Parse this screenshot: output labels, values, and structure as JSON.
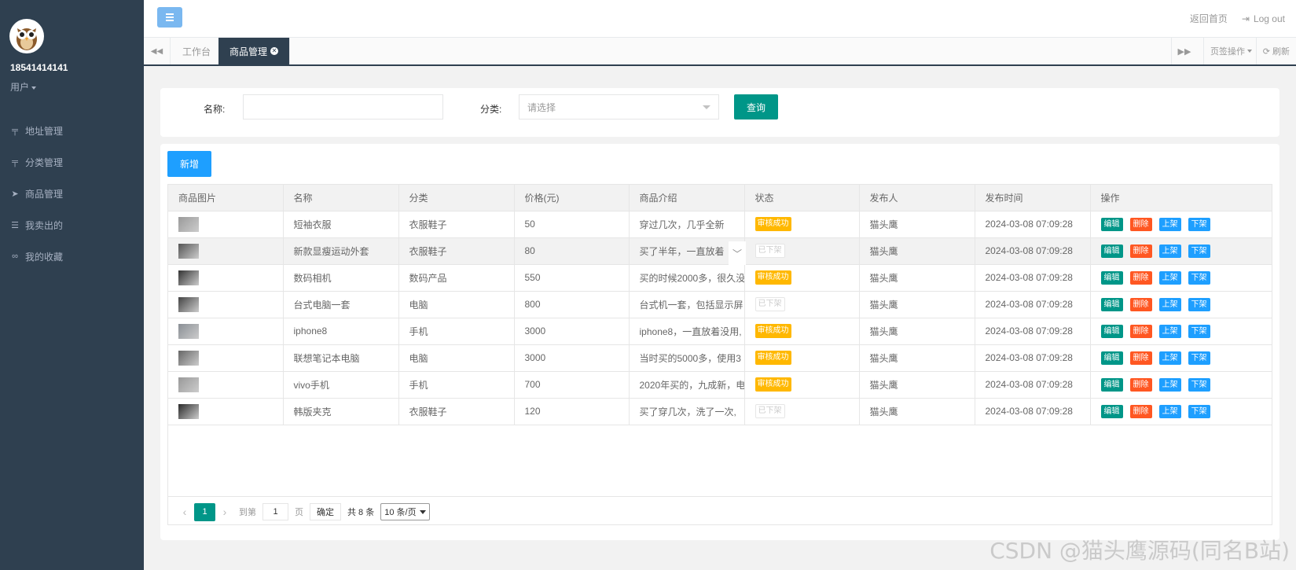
{
  "user": {
    "name": "18541414141",
    "role": "用户"
  },
  "menu": [
    {
      "label": "地址管理",
      "icon": "road-icon"
    },
    {
      "label": "分类管理",
      "icon": "road-icon"
    },
    {
      "label": "商品管理",
      "icon": "paper-plane-icon"
    },
    {
      "label": "我卖出的",
      "icon": "sliders-icon"
    },
    {
      "label": "我的收藏",
      "icon": "link-icon"
    }
  ],
  "header": {
    "home_label": "返回首页",
    "logout_label": "Log out"
  },
  "tabs": [
    {
      "label": "工作台",
      "active": false
    },
    {
      "label": "商品管理",
      "active": true
    }
  ],
  "tab_actions": {
    "page_ops": "页签操作",
    "refresh": "刷新"
  },
  "search": {
    "name_label": "名称:",
    "name_value": "",
    "category_label": "分类:",
    "category_placeholder": "请选择",
    "query_button": "查询"
  },
  "toolbar": {
    "add_button": "新增"
  },
  "table": {
    "columns": [
      "商品图片",
      "名称",
      "分类",
      "价格(元)",
      "商品介绍",
      "状态",
      "发布人",
      "发布时间",
      "操作"
    ],
    "actions": {
      "edit": "编辑",
      "delete": "删除",
      "list": "上架",
      "delist": "下架"
    },
    "rows": [
      {
        "name": "短袖衣服",
        "category": "衣服鞋子",
        "price": "50",
        "intro": "穿过几次，几乎全新",
        "status": "审核成功",
        "status_type": "ok",
        "publisher": "猫头鹰",
        "time": "2024-03-08 07:09:28"
      },
      {
        "name": "新款显瘦运动外套",
        "category": "衣服鞋子",
        "price": "80",
        "intro": "买了半年，一直放着",
        "status": "已下架",
        "status_type": "off",
        "publisher": "猫头鹰",
        "time": "2024-03-08 07:09:28"
      },
      {
        "name": "数码相机",
        "category": "数码产品",
        "price": "550",
        "intro": "买的时候2000多，很久没",
        "status": "审核成功",
        "status_type": "ok",
        "publisher": "猫头鹰",
        "time": "2024-03-08 07:09:28"
      },
      {
        "name": "台式电脑一套",
        "category": "电脑",
        "price": "800",
        "intro": "台式机一套，包括显示屏",
        "status": "已下架",
        "status_type": "off",
        "publisher": "猫头鹰",
        "time": "2024-03-08 07:09:28"
      },
      {
        "name": "iphone8",
        "category": "手机",
        "price": "3000",
        "intro": "iphone8，一直放着没用,",
        "status": "审核成功",
        "status_type": "ok",
        "publisher": "猫头鹰",
        "time": "2024-03-08 07:09:28"
      },
      {
        "name": "联想笔记本电脑",
        "category": "电脑",
        "price": "3000",
        "intro": "当时买的5000多，使用3",
        "status": "审核成功",
        "status_type": "ok",
        "publisher": "猫头鹰",
        "time": "2024-03-08 07:09:28"
      },
      {
        "name": "vivo手机",
        "category": "手机",
        "price": "700",
        "intro": "2020年买的，九成新，电",
        "status": "审核成功",
        "status_type": "ok",
        "publisher": "猫头鹰",
        "time": "2024-03-08 07:09:28"
      },
      {
        "name": "韩版夹克",
        "category": "衣服鞋子",
        "price": "120",
        "intro": "买了穿几次，洗了一次,",
        "status": "已下架",
        "status_type": "off",
        "publisher": "猫头鹰",
        "time": "2024-03-08 07:09:28"
      }
    ]
  },
  "pagination": {
    "current_page": "1",
    "goto_label": "到第",
    "goto_value": "1",
    "page_unit": "页",
    "confirm": "确定",
    "total": "共 8 条",
    "page_size": "10 条/页"
  },
  "watermark": "CSDN @猫头鹰源码(同名B站)",
  "colors": {
    "sidebar": "#2f4050",
    "primary": "#009688",
    "danger": "#ff5722",
    "info": "#1e9fff",
    "warning": "#ffb800"
  }
}
